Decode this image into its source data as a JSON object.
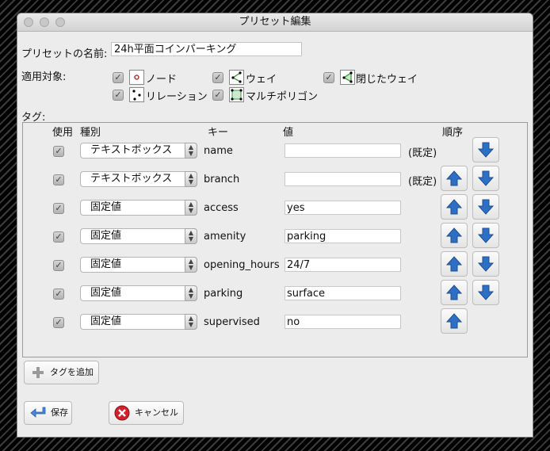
{
  "window": {
    "title": "プリセット編集"
  },
  "preset_name": {
    "label": "プリセットの名前:",
    "value": "24h平面コインパーキング"
  },
  "applies_to": {
    "label": "適用対象:",
    "items": [
      {
        "label": "ノード",
        "checked": true,
        "icon": "node-icon"
      },
      {
        "label": "ウェイ",
        "checked": true,
        "icon": "way-icon"
      },
      {
        "label": "閉じたウェイ",
        "checked": true,
        "icon": "closed-way-icon"
      },
      {
        "label": "リレーション",
        "checked": true,
        "icon": "relation-icon"
      },
      {
        "label": "マルチポリゴン",
        "checked": true,
        "icon": "multipolygon-icon"
      }
    ]
  },
  "tags": {
    "label": "タグ:",
    "headers": {
      "use": "使用",
      "type": "種別",
      "key": "キー",
      "value": "値",
      "order": "順序"
    },
    "rows": [
      {
        "checked": true,
        "type": "テキストボックス",
        "key": "name",
        "value": "",
        "note": "(既定)",
        "up": false,
        "down": true
      },
      {
        "checked": true,
        "type": "テキストボックス",
        "key": "branch",
        "value": "",
        "note": "(既定)",
        "up": true,
        "down": true
      },
      {
        "checked": true,
        "type": "固定値",
        "key": "access",
        "value": "yes",
        "note": "",
        "up": true,
        "down": true
      },
      {
        "checked": true,
        "type": "固定値",
        "key": "amenity",
        "value": "parking",
        "note": "",
        "up": true,
        "down": true
      },
      {
        "checked": true,
        "type": "固定値",
        "key": "opening_hours",
        "value": "24/7",
        "note": "",
        "up": true,
        "down": true
      },
      {
        "checked": true,
        "type": "固定値",
        "key": "parking",
        "value": "surface",
        "note": "",
        "up": true,
        "down": true
      },
      {
        "checked": true,
        "type": "固定値",
        "key": "supervised",
        "value": "no",
        "note": "",
        "up": true,
        "down": false
      }
    ]
  },
  "buttons": {
    "add_tag": "タグを追加",
    "save": "保存",
    "cancel": "キャンセル"
  },
  "colors": {
    "arrow_blue": "#2d6fc4",
    "cancel_red": "#d4202a",
    "save_blue": "#4c86d6"
  }
}
